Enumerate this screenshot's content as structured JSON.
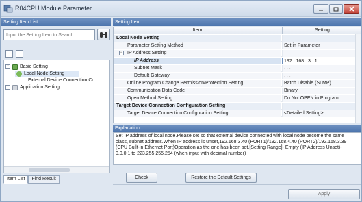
{
  "window": {
    "title": "R04CPU Module Parameter"
  },
  "left": {
    "header": "Setting Item List",
    "search_placeholder": "Input the Setting Item to Search",
    "tree": [
      {
        "label": "Basic Setting",
        "expander": "−"
      },
      {
        "label": "Local Node Setting"
      },
      {
        "label": "External Device Connection Co"
      },
      {
        "label": "Application Setting",
        "expander": "+"
      }
    ],
    "tabs": [
      "Item List",
      "Find Result"
    ]
  },
  "right": {
    "header": "Setting Item",
    "columns": {
      "item": "Item",
      "setting": "Setting"
    },
    "rows": [
      {
        "item": "Local Node Setting",
        "value": "",
        "kind": "grp",
        "exp": "−"
      },
      {
        "item": "Parameter Setting Method",
        "value": "Set in Parameter",
        "kind": "sub"
      },
      {
        "item": "IP Address Setting",
        "value": "",
        "kind": "sub",
        "exp": "−"
      },
      {
        "item": "IP Address",
        "value": "192 . 168 . 3 . 1",
        "kind": "hl"
      },
      {
        "item": "Subnet Mask",
        "value": ".  .  .",
        "kind": "sub"
      },
      {
        "item": "Default Gateway",
        "value": ".  .  .",
        "kind": "sub"
      },
      {
        "item": "Online Program Change Permission/Protection Setting",
        "value": "Batch Disable (SLMP)",
        "kind": "sub"
      },
      {
        "item": "Communication Data Code",
        "value": "Binary",
        "kind": "sub"
      },
      {
        "item": "Open Method Setting",
        "value": "Do Not OPEN in Program",
        "kind": "sub"
      },
      {
        "item": "Target Device Connection Configuration Setting",
        "value": "",
        "kind": "grp",
        "exp": "−"
      },
      {
        "item": "Target Device Connection Configuration Setting",
        "value": "<Detailed Setting>",
        "kind": "sub"
      }
    ]
  },
  "explanation": {
    "header": "Explanation",
    "text": "Set IP address of local node.Please set so that external device connected with local node become the same class, subnet address.When IP address is unset,192.168.3.40 (PORT1)/192.168.4.40 (PORT2)/192.168.3.39 (CPU Built-in Ethernet Port)Operation as the one has been set.[Setting Range]- Empty (IP Address Unset)- 0.0.0.1 to 223.255.255.254 (when input with decimal number)"
  },
  "buttons": {
    "check": "Check",
    "restore": "Restore the Default Settings",
    "apply": "Apply"
  },
  "colors": {
    "header_blue": "#5a80b6",
    "window_bg": "#dfe7f1",
    "highlight": "#d7e3f2"
  }
}
